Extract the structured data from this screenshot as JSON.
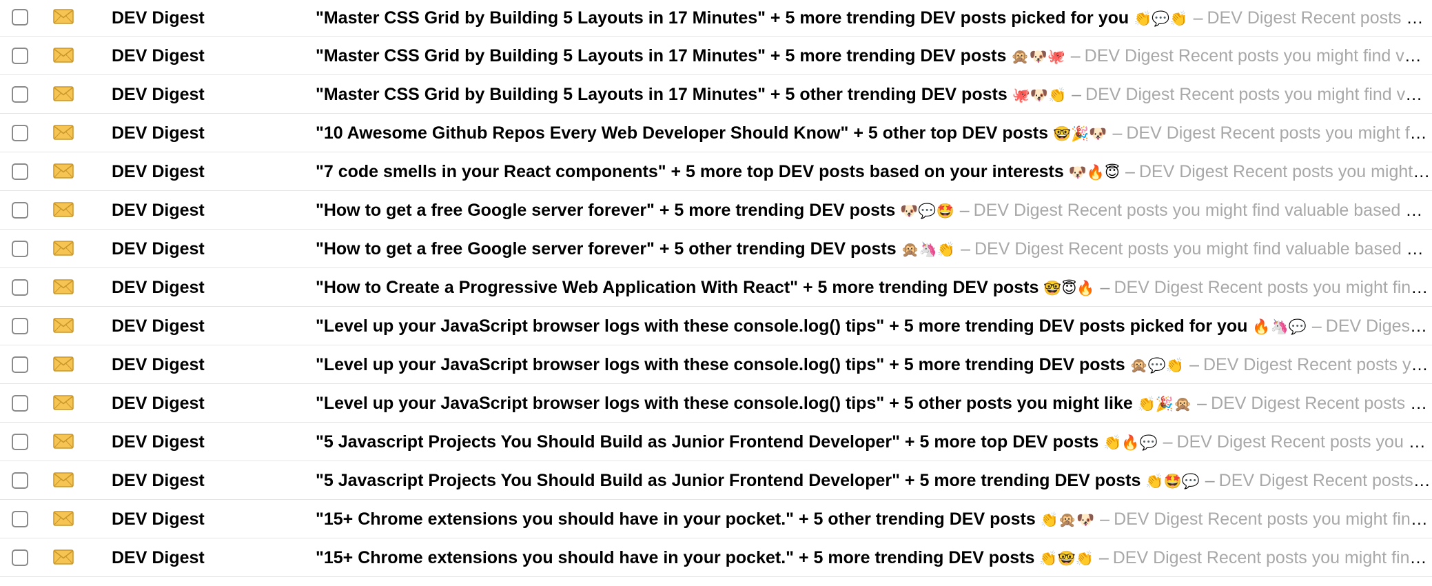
{
  "rows": [
    {
      "sender": "DEV Digest",
      "subject": "\"Master CSS Grid by Building 5 Layouts in 17 Minutes\" + 5 more trending DEV posts picked for you",
      "emoji": "👏💬👏",
      "preview": "DEV Digest Recent posts you might find valuable based on your interests"
    },
    {
      "sender": "DEV Digest",
      "subject": "\"Master CSS Grid by Building 5 Layouts in 17 Minutes\" + 5 more trending DEV posts",
      "emoji": "🙊🐶🐙",
      "preview": "DEV Digest Recent posts you might find valuable based on your interests"
    },
    {
      "sender": "DEV Digest",
      "subject": "\"Master CSS Grid by Building 5 Layouts in 17 Minutes\" + 5 other trending DEV posts",
      "emoji": "🐙🐶👏",
      "preview": "DEV Digest Recent posts you might find valuable based on your interests"
    },
    {
      "sender": "DEV Digest",
      "subject": "\"10 Awesome Github Repos Every Web Developer Should Know\" + 5 other top DEV posts",
      "emoji": "🤓🎉🐶",
      "preview": "DEV Digest Recent posts you might find valuable based on your interests"
    },
    {
      "sender": "DEV Digest",
      "subject": "\"7 code smells in your React components\" + 5 more top DEV posts based on your interests",
      "emoji": "🐶🔥😇",
      "preview": "DEV Digest Recent posts you might find valuable based on your interests"
    },
    {
      "sender": "DEV Digest",
      "subject": "\"How to get a free Google server forever\" + 5 more trending DEV posts",
      "emoji": "🐶💬🤩",
      "preview": "DEV Digest Recent posts you might find valuable based on your interests"
    },
    {
      "sender": "DEV Digest",
      "subject": "\"How to get a free Google server forever\" + 5 other trending DEV posts",
      "emoji": "🙊🦄👏",
      "preview": "DEV Digest Recent posts you might find valuable based on your interests"
    },
    {
      "sender": "DEV Digest",
      "subject": "\"How to Create a Progressive Web Application With React\" + 5 more trending DEV posts",
      "emoji": "🤓😇🔥",
      "preview": "DEV Digest Recent posts you might find valuable based on your interests"
    },
    {
      "sender": "DEV Digest",
      "subject": "\"Level up your JavaScript browser logs with these console.log() tips\" + 5 more trending DEV posts picked for you",
      "emoji": "🔥🦄💬",
      "preview": "DEV Digest Recent posts you might find valuable based on your interests"
    },
    {
      "sender": "DEV Digest",
      "subject": "\"Level up your JavaScript browser logs with these console.log() tips\" + 5 more trending DEV posts",
      "emoji": "🙊💬👏",
      "preview": "DEV Digest Recent posts you might find valuable based on your interests"
    },
    {
      "sender": "DEV Digest",
      "subject": "\"Level up your JavaScript browser logs with these console.log() tips\" + 5 other posts you might like",
      "emoji": "👏🎉🙊",
      "preview": "DEV Digest Recent posts you might find valuable based on your interests"
    },
    {
      "sender": "DEV Digest",
      "subject": "\"5 Javascript Projects You Should Build as Junior Frontend Developer\" + 5 more top DEV posts",
      "emoji": "👏🔥💬",
      "preview": "DEV Digest Recent posts you might find valuable based on your interests"
    },
    {
      "sender": "DEV Digest",
      "subject": "\"5 Javascript Projects You Should Build as Junior Frontend Developer\" + 5 more trending DEV posts",
      "emoji": "👏🤩💬",
      "preview": "DEV Digest Recent posts you might find valuable based on your interests"
    },
    {
      "sender": "DEV Digest",
      "subject": "\"15+ Chrome extensions you should have in your pocket.\" + 5 other trending DEV posts",
      "emoji": "👏🙊🐶",
      "preview": "DEV Digest Recent posts you might find valuable based on your interests"
    },
    {
      "sender": "DEV Digest",
      "subject": "\"15+ Chrome extensions you should have in your pocket.\" + 5 more trending DEV posts",
      "emoji": "👏🤓👏",
      "preview": "DEV Digest Recent posts you might find valuable based on your interests"
    }
  ],
  "separator": "–",
  "colors": {
    "subject": "#000000",
    "preview": "#a8a8a8",
    "divider": "#e4e4e4",
    "envelope_fill": "#f6c453",
    "envelope_stroke": "#c9962a"
  },
  "icons": {
    "select": "checkbox-icon",
    "read_state": "envelope-icon"
  }
}
